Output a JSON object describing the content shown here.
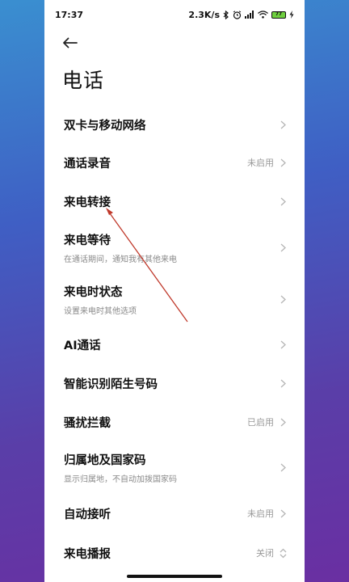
{
  "status_bar": {
    "time": "17:37",
    "speed": "2.3K/s",
    "battery": "77",
    "icons": [
      "bluetooth-icon",
      "alarm-icon",
      "signal-icon",
      "wifi-icon",
      "battery-icon",
      "charging-icon"
    ]
  },
  "header": {
    "back_icon": "arrow-left-icon",
    "title": "电话"
  },
  "settings": [
    {
      "label": "双卡与移动网络",
      "sub": "",
      "value": ""
    },
    {
      "label": "通话录音",
      "sub": "",
      "value": "未启用"
    },
    {
      "label": "来电转接",
      "sub": "",
      "value": ""
    },
    {
      "label": "来电等待",
      "sub": "在通话期间，通知我有其他来电",
      "value": ""
    },
    {
      "label": "来电时状态",
      "sub": "设置来电时其他选项",
      "value": ""
    },
    {
      "label": "AI通话",
      "sub": "",
      "value": ""
    },
    {
      "label": "智能识别陌生号码",
      "sub": "",
      "value": ""
    },
    {
      "label": "骚扰拦截",
      "sub": "",
      "value": "已启用"
    },
    {
      "label": "归属地及国家码",
      "sub": "显示归属地，不自动加拨国家码",
      "value": ""
    },
    {
      "label": "自动接听",
      "sub": "",
      "value": "未启用"
    },
    {
      "label": "来电播报",
      "sub": "",
      "value": "关闭"
    }
  ],
  "colors": {
    "annotation_arrow": "#c0392b",
    "text_primary": "#111111",
    "text_secondary": "#8a8a8a"
  }
}
